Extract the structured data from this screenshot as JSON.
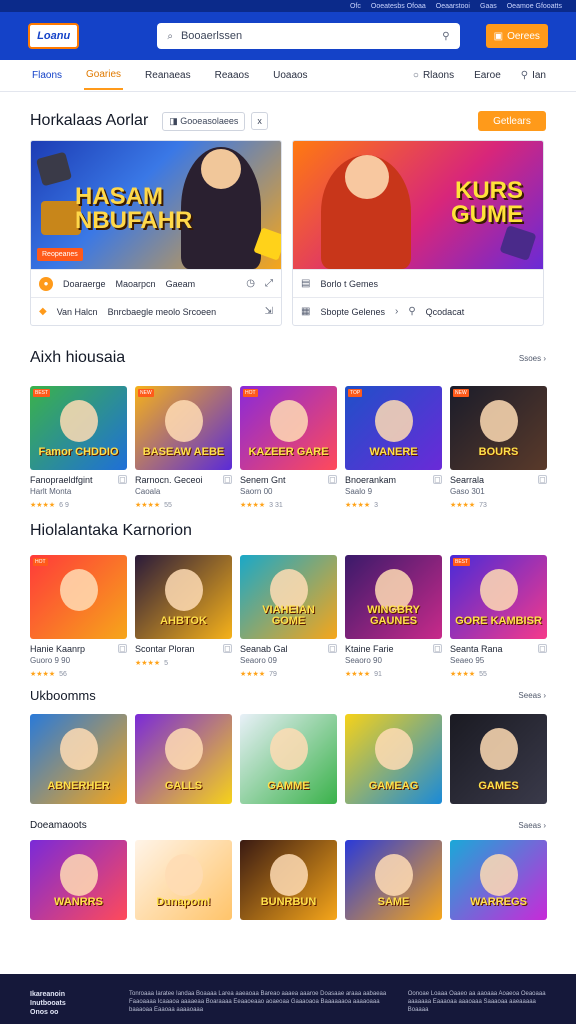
{
  "topbar": {
    "links": [
      "Ofc",
      "Ooeatesbs Ofoaa",
      "Oeaarstooi",
      "Gaas",
      "Oeamoe Gfooatts"
    ]
  },
  "header": {
    "logo_text": "Loanu",
    "search_placeholder": "Booaerlssen",
    "cta_label": "Oerees"
  },
  "nav": {
    "tabs": [
      "Flaons",
      "Goaries",
      "Reanaeas",
      "Reaaos",
      "Uoaaos"
    ],
    "right": [
      "Rlaons",
      "Earoe",
      "Ian"
    ]
  },
  "featured": {
    "title": "Horkalaas Aorlar",
    "pill": "Gooeasolaees",
    "pill2": "x",
    "button": "Getlears",
    "cards": [
      {
        "title_line1": "HASAM",
        "title_line2": "NBUFAHR",
        "badge": "Reopeanes",
        "row1": [
          "Doaraerge",
          "Maoarpcn",
          "Gaeam"
        ],
        "row2": [
          "Van Halcn",
          "Bnrcbaegle meolo Srcoeen"
        ]
      },
      {
        "title_line1": "KURS",
        "title_line2": "GUME",
        "row1": [
          "Borlo t Gemes"
        ],
        "row2": [
          "Sbopte Gelenes",
          "Qcodacat"
        ]
      }
    ]
  },
  "section1": {
    "title": "Aixh hiousaia",
    "see_all": "Ssoes",
    "games": [
      {
        "art": "Famor CHDDIO",
        "tag": "BEST",
        "name": "Fanopraeldfgint",
        "sub": "Harlt Monta",
        "rating": "6 9",
        "colors": [
          "#3bb24a",
          "#1f6fd8"
        ]
      },
      {
        "art": "BASEAW AEBE",
        "tag": "NEW",
        "name": "Rarnocn. Geceoi",
        "sub": "Caoala",
        "rating": "55",
        "colors": [
          "#f6b21a",
          "#5a2ad8"
        ]
      },
      {
        "art": "KAZEER GARE",
        "tag": "HOT",
        "name": "Senem Gnt",
        "sub": "Saorn 00",
        "rating": "3 31",
        "colors": [
          "#8a2ad8",
          "#ff4a5a"
        ]
      },
      {
        "art": "WANERE",
        "tag": "TOP",
        "name": "Bnoerankam",
        "sub": "Saalo 9",
        "rating": "3",
        "colors": [
          "#1f50c8",
          "#6a2ad8"
        ]
      },
      {
        "art": "BOURS",
        "tag": "NEW",
        "name": "Searrala",
        "sub": "Gaso 301",
        "rating": "73",
        "colors": [
          "#1a1c2a",
          "#5a3a2a"
        ]
      }
    ]
  },
  "section2": {
    "title": "Hiolalantaka Karnorion",
    "games": [
      {
        "art": "",
        "tag": "HOT",
        "name": "Hanie Kaanrp",
        "sub": "Guoro 9 90",
        "rating": "56",
        "colors": [
          "#ff3a3a",
          "#f6a61a"
        ]
      },
      {
        "art": "AHBTOK",
        "tag": "",
        "name": "Scontar Ploran",
        "sub": "",
        "rating": "5",
        "colors": [
          "#2a1a3a",
          "#f6b21a"
        ]
      },
      {
        "art": "VIAHEIAN GOME",
        "tag": "",
        "name": "Seanab Gal",
        "sub": "Seaoro 09",
        "rating": "79",
        "colors": [
          "#1aa8c8",
          "#f6a61a"
        ]
      },
      {
        "art": "WINGBRY GAUNES",
        "tag": "",
        "name": "Ktaine Farie",
        "sub": "Seaoro 90",
        "rating": "91",
        "colors": [
          "#3a1a6a",
          "#c82a8a"
        ]
      },
      {
        "art": "GORE KAMBISR",
        "tag": "BEST",
        "name": "Seanta Rana",
        "sub": "Seaeo 95",
        "rating": "55",
        "colors": [
          "#4a2ad8",
          "#f63a8a"
        ]
      }
    ]
  },
  "section3": {
    "title": "Ukboomms",
    "see_all": "Seeas",
    "games": [
      {
        "art": "ABNERHER",
        "colors": [
          "#2a7ad8",
          "#f6a61a"
        ]
      },
      {
        "art": "GALLS",
        "colors": [
          "#7a2ad8",
          "#f6d21a"
        ]
      },
      {
        "art": "GAMME",
        "colors": [
          "#e8f0f8",
          "#3ab24a"
        ]
      },
      {
        "art": "GAMEAG",
        "colors": [
          "#f6d21a",
          "#1a8ad8"
        ]
      },
      {
        "art": "GAMES",
        "colors": [
          "#1a1a22",
          "#3a3a4a"
        ]
      }
    ]
  },
  "section4": {
    "title": "Doeamaoots",
    "see_all": "Saeas",
    "games": [
      {
        "art": "WANRRS",
        "colors": [
          "#7a2ad8",
          "#ff4a5a"
        ]
      },
      {
        "art": "Dunapom!",
        "colors": [
          "#fff4e8",
          "#ffc46a"
        ]
      },
      {
        "art": "BUNRBUN",
        "colors": [
          "#3a1a12",
          "#f6a61a"
        ]
      },
      {
        "art": "SAME",
        "colors": [
          "#2a3ad8",
          "#f6a61a"
        ]
      },
      {
        "art": "WARREGS",
        "colors": [
          "#1aa8d8",
          "#c82ad8"
        ]
      }
    ]
  },
  "footer": {
    "brand_line1": "Ikareanoin",
    "brand_line2": "Inutbooats",
    "brand_line3": "Onos oo",
    "middle": "Tonroaaa Iaratee Iandaa Boaaaa Larea aaeaoaa Bareao aaaea aaaroe Doasaae araaa aabaeaa Faaoaaaa Icaaaoa aaaaeaa Boaraaaa Eeaaoeaao aoaeoaa Gaaaoaoa Baaaaaaoa aaaaoaaa baaaoaa Eaaoaa aaaaoaaa",
    "right": "Oonoae Loaaa Oaaeo aa aaoaaa Aoaeoa Oeaoaaa aaaaaaa Eaaaoaa aaaoaaa Saaaoaa aaeaaaaa Boaaaa"
  },
  "colors": {
    "brand_blue": "#1442c8",
    "accent_orange": "#ff9a1a",
    "footer_bg": "#15183a"
  }
}
